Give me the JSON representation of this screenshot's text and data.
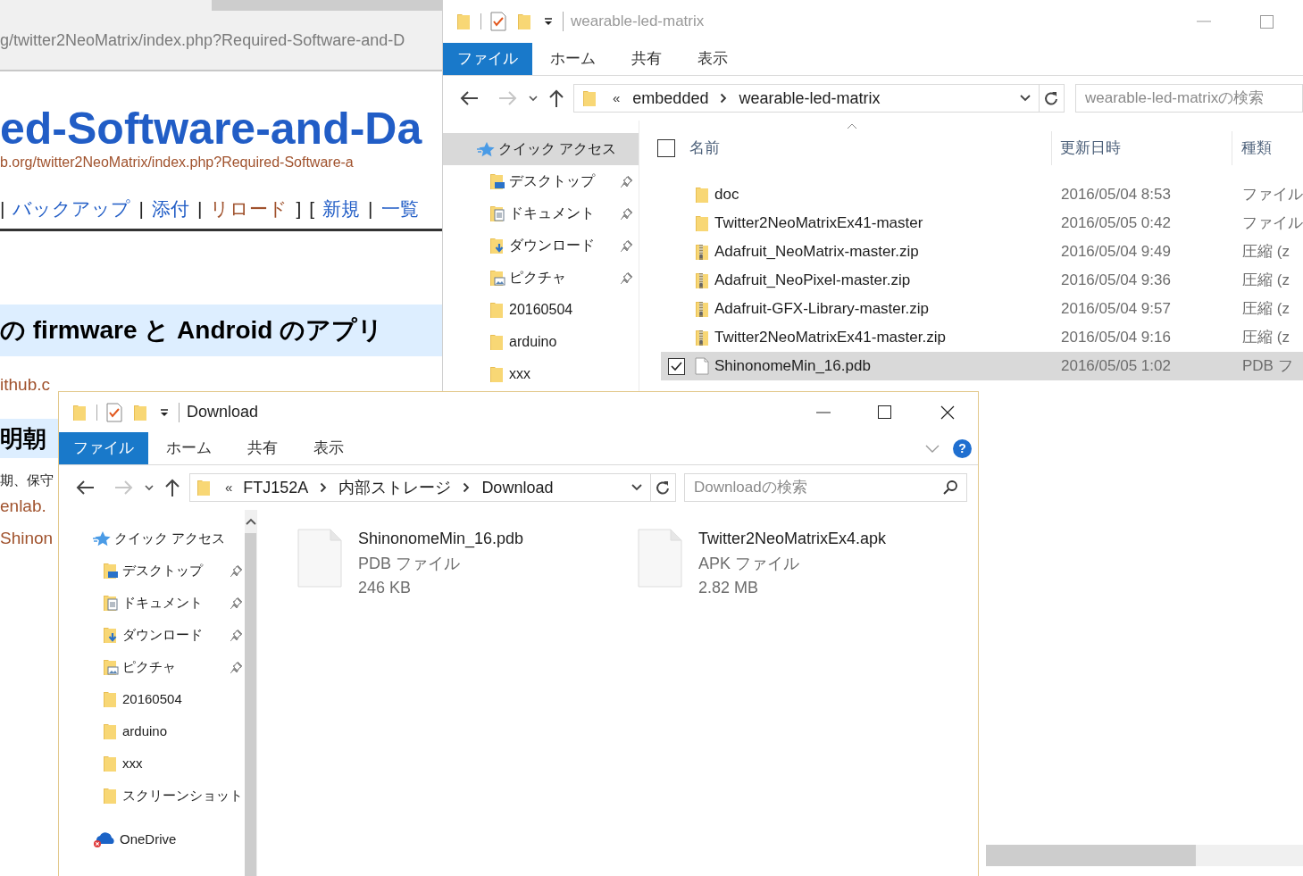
{
  "browser": {
    "address": "g/twitter2NeoMatrix/index.php?Required-Software-and-D",
    "page_title": "ed-Software-and-Da",
    "page_url": "b.org/twitter2NeoMatrix/index.php?Required-Software-a",
    "nav_links": [
      {
        "text": "|",
        "kind": "sep"
      },
      {
        "text": "バックアップ",
        "kind": "link",
        "visited": false
      },
      {
        "text": "|",
        "kind": "sep"
      },
      {
        "text": "添付",
        "kind": "link",
        "visited": false
      },
      {
        "text": "|",
        "kind": "sep"
      },
      {
        "text": "リロード",
        "kind": "link",
        "visited": true
      },
      {
        "text": "]",
        "kind": "sep"
      },
      {
        "text": "[",
        "kind": "sep"
      },
      {
        "text": "新規",
        "kind": "link",
        "visited": false
      },
      {
        "text": "|",
        "kind": "sep"
      },
      {
        "text": "一覧",
        "kind": "link",
        "visited": false
      }
    ],
    "section_heading": "の firmware と Android のアプリ",
    "github_link": "ithub.c",
    "subheading": "明朝",
    "body_text": "期、保守",
    "link_2": "enlab.",
    "link_3": "Shinon"
  },
  "explorer_back": {
    "title": "wearable-led-matrix",
    "ribbon_tabs": [
      {
        "label": "ファイル",
        "selected": true
      },
      {
        "label": "ホーム",
        "selected": false
      },
      {
        "label": "共有",
        "selected": false
      },
      {
        "label": "表示",
        "selected": false
      }
    ],
    "path_overflow": "«",
    "path": [
      "embedded",
      "wearable-led-matrix"
    ],
    "search": {
      "placeholder": "wearable-led-matrixの検索"
    },
    "nav": [
      {
        "label": "クイック アクセス",
        "kind": "star",
        "selected": true,
        "children": [
          {
            "label": "デスクトップ",
            "kind": "desktop",
            "pinned": true,
            "selected": false
          },
          {
            "label": "ドキュメント",
            "kind": "documents",
            "pinned": true,
            "selected": false
          },
          {
            "label": "ダウンロード",
            "kind": "downloads",
            "pinned": true,
            "selected": false
          },
          {
            "label": "ピクチャ",
            "kind": "pictures",
            "pinned": true,
            "selected": false
          },
          {
            "label": "20160504",
            "kind": "folder",
            "pinned": false,
            "selected": false
          },
          {
            "label": "arduino",
            "kind": "folder",
            "pinned": false,
            "selected": false
          },
          {
            "label": "xxx",
            "kind": "folder",
            "pinned": false,
            "selected": false
          }
        ]
      }
    ],
    "header_checkbox": {
      "checked": false
    },
    "columns": [
      "名前",
      "更新日時",
      "種類"
    ],
    "files": [
      {
        "name": "doc",
        "modified": "2016/05/04 8:53",
        "type": "ファイル",
        "kind": "folder",
        "checked": false,
        "selected": false
      },
      {
        "name": "Twitter2NeoMatrixEx41-master",
        "modified": "2016/05/05 0:42",
        "type": "ファイル",
        "kind": "folder",
        "checked": false,
        "selected": false
      },
      {
        "name": "Adafruit_NeoMatrix-master.zip",
        "modified": "2016/05/04 9:49",
        "type": "圧縮 (z",
        "kind": "zip",
        "checked": false,
        "selected": false
      },
      {
        "name": "Adafruit_NeoPixel-master.zip",
        "modified": "2016/05/04 9:36",
        "type": "圧縮 (z",
        "kind": "zip",
        "checked": false,
        "selected": false
      },
      {
        "name": "Adafruit-GFX-Library-master.zip",
        "modified": "2016/05/04 9:57",
        "type": "圧縮 (z",
        "kind": "zip",
        "checked": false,
        "selected": false
      },
      {
        "name": "Twitter2NeoMatrixEx41-master.zip",
        "modified": "2016/05/04 9:16",
        "type": "圧縮 (z",
        "kind": "zip",
        "checked": false,
        "selected": false
      },
      {
        "name": "ShinonomeMin_16.pdb",
        "modified": "2016/05/05 1:02",
        "type": "PDB フ",
        "kind": "file",
        "checked": true,
        "selected": true
      }
    ]
  },
  "explorer_front": {
    "title": "Download",
    "ribbon_tabs": [
      {
        "label": "ファイル",
        "selected": true
      },
      {
        "label": "ホーム",
        "selected": false
      },
      {
        "label": "共有",
        "selected": false
      },
      {
        "label": "表示",
        "selected": false
      }
    ],
    "help_label": "?",
    "path_overflow": "«",
    "path": [
      "FTJ152A",
      "内部ストレージ",
      "Download"
    ],
    "search": {
      "placeholder": "Downloadの検索"
    },
    "nav": [
      {
        "label": "クイック アクセス",
        "kind": "star",
        "selected": false,
        "children": [
          {
            "label": "デスクトップ",
            "kind": "desktop",
            "pinned": true,
            "selected": false
          },
          {
            "label": "ドキュメント",
            "kind": "documents",
            "pinned": true,
            "selected": false
          },
          {
            "label": "ダウンロード",
            "kind": "downloads",
            "pinned": true,
            "selected": false
          },
          {
            "label": "ピクチャ",
            "kind": "pictures",
            "pinned": true,
            "selected": false
          },
          {
            "label": "20160504",
            "kind": "folder",
            "pinned": false,
            "selected": false
          },
          {
            "label": "arduino",
            "kind": "folder",
            "pinned": false,
            "selected": false
          },
          {
            "label": "xxx",
            "kind": "folder",
            "pinned": false,
            "selected": false
          },
          {
            "label": "スクリーンショット",
            "kind": "folder",
            "pinned": false,
            "selected": false
          }
        ]
      },
      {
        "label": "OneDrive",
        "kind": "cloud",
        "selected": false
      }
    ],
    "files": [
      {
        "name": "ShinonomeMin_16.pdb",
        "type": "PDB ファイル",
        "size": "246 KB",
        "kind": "file"
      },
      {
        "name": "Twitter2NeoMatrixEx4.apk",
        "type": "APK ファイル",
        "size": "2.82 MB",
        "kind": "file"
      }
    ]
  }
}
